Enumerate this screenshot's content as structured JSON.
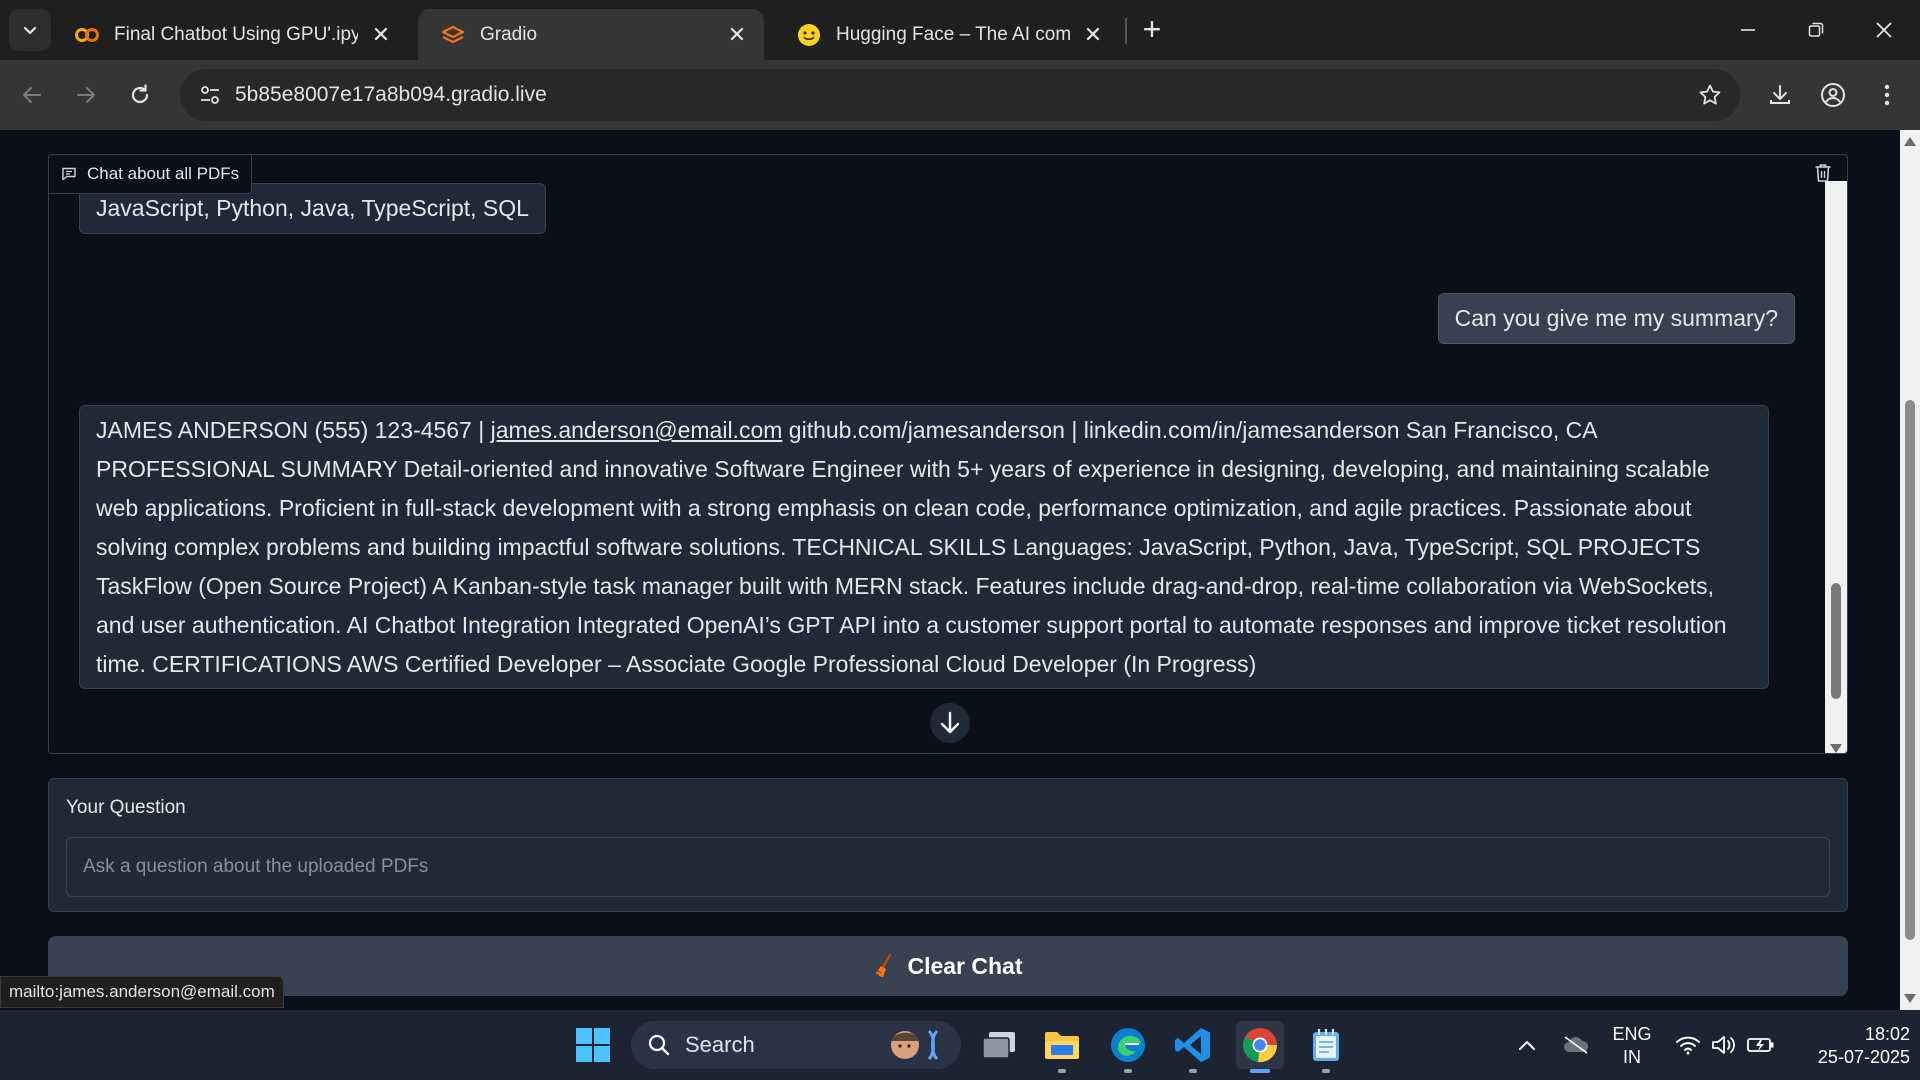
{
  "browser": {
    "tabs": [
      {
        "title": "Final Chatbot Using GPU'.ipynb",
        "icon": "colab-icon"
      },
      {
        "title": "Gradio",
        "icon": "gradio-icon"
      },
      {
        "title": "Hugging Face – The AI commu",
        "icon": "huggingface-icon"
      }
    ],
    "url": "5b85e8007e17a8b094.gradio.live",
    "status_url": "mailto:james.anderson@email.com"
  },
  "chat": {
    "label": "Chat about all PDFs",
    "messages": [
      {
        "role": "bot",
        "text": "JavaScript, Python, Java, TypeScript, SQL"
      },
      {
        "role": "user",
        "text": "Can you give me my summary?"
      },
      {
        "role": "bot",
        "pre": "JAMES ANDERSON (555) 123-4567 | ",
        "email": "james.anderson@email.com",
        "post": " github.com/jamesanderson | linkedin.com/in/jamesanderson San Francisco, CA PROFESSIONAL SUMMARY Detail-oriented and innovative Software Engineer with 5+ years of experience in designing, developing, and maintaining scalable web applications. Proficient in full-stack development with a strong emphasis on clean code, performance optimization, and agile practices. Passionate about solving complex problems and building impactful software solutions. TECHNICAL SKILLS Languages: JavaScript, Python, Java, TypeScript, SQL PROJECTS TaskFlow (Open Source Project) A Kanban-style task manager built with MERN stack. Features include drag-and-drop, real-time collaboration via WebSockets, and user authentication. AI Chatbot Integration Integrated OpenAI’s GPT API into a customer support portal to automate responses and improve ticket resolution time. CERTIFICATIONS AWS Certified Developer – Associate Google Professional Cloud Developer (In Progress)"
      }
    ]
  },
  "question": {
    "label": "Your Question",
    "placeholder": "Ask a question about the uploaded PDFs",
    "value": ""
  },
  "clear_button": {
    "label": "Clear Chat",
    "icon": "broom-icon"
  },
  "taskbar": {
    "search_label": "Search",
    "lang_line1": "ENG",
    "lang_line2": "IN",
    "time": "18:02",
    "date": "25-07-2025"
  },
  "colors": {
    "page_bg": "#0b0f19",
    "panel_bg": "#1f2937",
    "border": "#374151",
    "text": "#e5e7eb",
    "chrome_tabstrip": "#1f1f1f",
    "chrome_toolbar": "#353535",
    "taskbar": "#1c2434"
  }
}
